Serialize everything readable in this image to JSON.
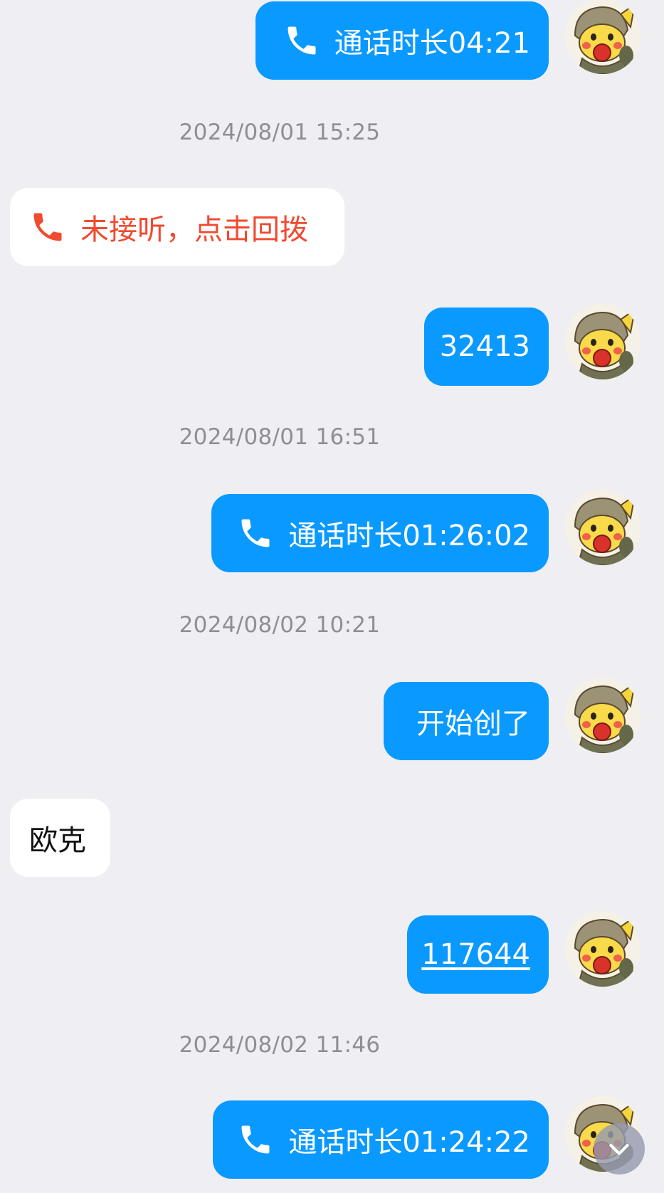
{
  "colors": {
    "background": "#EFEFF3",
    "sent_bubble": "#0A99FF",
    "received_bubble": "#FFFFFF",
    "missed_call_text": "#F04A2F",
    "timestamp_text": "#8E8E93"
  },
  "icons": {
    "call": "phone-icon",
    "avatar": "pikachu-avatar",
    "scroll_down": "chevron-down-icon"
  },
  "messages": [
    {
      "kind": "call",
      "direction": "sent",
      "text": "通话时长04:21"
    },
    {
      "kind": "timestamp",
      "text": "2024/08/01 15:25"
    },
    {
      "kind": "missed_call",
      "direction": "received",
      "text": "未接听，点击回拨"
    },
    {
      "kind": "text",
      "direction": "sent",
      "text": "32413"
    },
    {
      "kind": "timestamp",
      "text": "2024/08/01 16:51"
    },
    {
      "kind": "call",
      "direction": "sent",
      "text": "通话时长01:26:02"
    },
    {
      "kind": "timestamp",
      "text": "2024/08/02 10:21"
    },
    {
      "kind": "text",
      "direction": "sent",
      "text": "开始创了"
    },
    {
      "kind": "text",
      "direction": "received",
      "text": "欧克"
    },
    {
      "kind": "link",
      "direction": "sent",
      "text": "117644"
    },
    {
      "kind": "timestamp",
      "text": "2024/08/02 11:46"
    },
    {
      "kind": "call",
      "direction": "sent",
      "text": "通话时长01:24:22"
    }
  ]
}
